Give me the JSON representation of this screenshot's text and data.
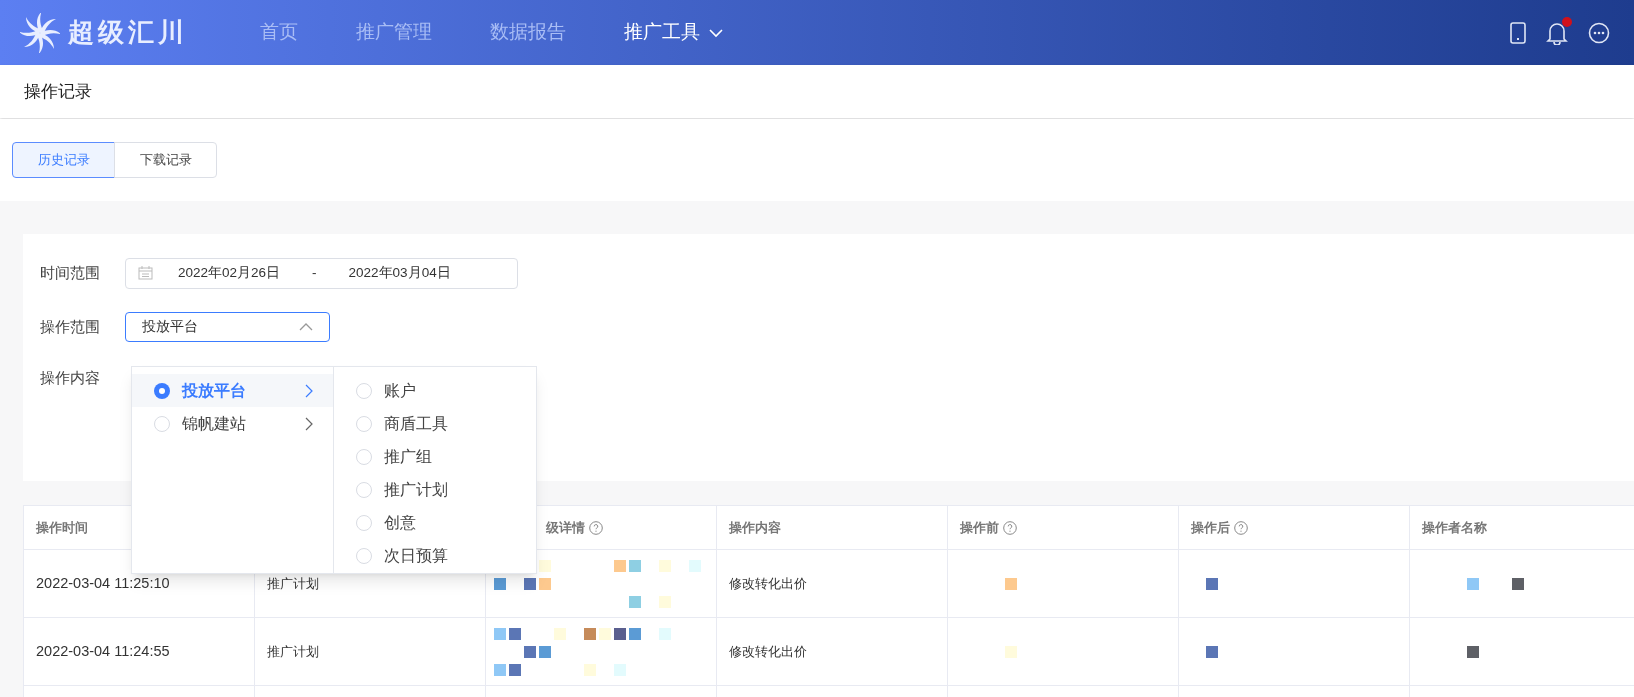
{
  "app": {
    "name": "超级汇川"
  },
  "nav": [
    {
      "label": "首页",
      "selected": false
    },
    {
      "label": "推广管理",
      "selected": false
    },
    {
      "label": "数据报告",
      "selected": false
    },
    {
      "label": "推广工具",
      "selected": true,
      "dropdown": true
    }
  ],
  "notifications": {
    "unread": true
  },
  "page_title": "操作记录",
  "tabs": [
    {
      "label": "历史记录",
      "selected": true
    },
    {
      "label": "下载记录",
      "selected": false
    }
  ],
  "filters": {
    "time_range": {
      "label": "时间范围",
      "start": "2022年02月26日",
      "separator": "-",
      "end": "2022年03月04日"
    },
    "scope": {
      "label": "操作范围",
      "value": "投放平台",
      "open": true
    },
    "content": {
      "label": "操作内容"
    }
  },
  "cascader": {
    "level_1": [
      {
        "label": "投放平台",
        "selected": true
      },
      {
        "label": "锦帆建站",
        "selected": false
      }
    ],
    "level_2": [
      {
        "label": "账户",
        "selected": false
      },
      {
        "label": "商盾工具",
        "selected": false
      },
      {
        "label": "推广组",
        "selected": false
      },
      {
        "label": "推广计划",
        "selected": false
      },
      {
        "label": "创意",
        "selected": false
      },
      {
        "label": "次日预算",
        "selected": false
      }
    ]
  },
  "table": {
    "columns": [
      {
        "label": "操作时间"
      },
      {
        "label": "级详情",
        "help": true
      },
      {
        "label": "操作内容"
      },
      {
        "label": "操作前",
        "help": true
      },
      {
        "label": "操作后",
        "help": true
      },
      {
        "label": "操作者名称"
      }
    ],
    "rows": [
      {
        "time": "2022-03-04 11:25:10",
        "level": "推广计划",
        "content": "修改转化出价"
      },
      {
        "time": "2022-03-04 11:24:55",
        "level": "推广计划",
        "content": "修改转化出价"
      }
    ]
  }
}
